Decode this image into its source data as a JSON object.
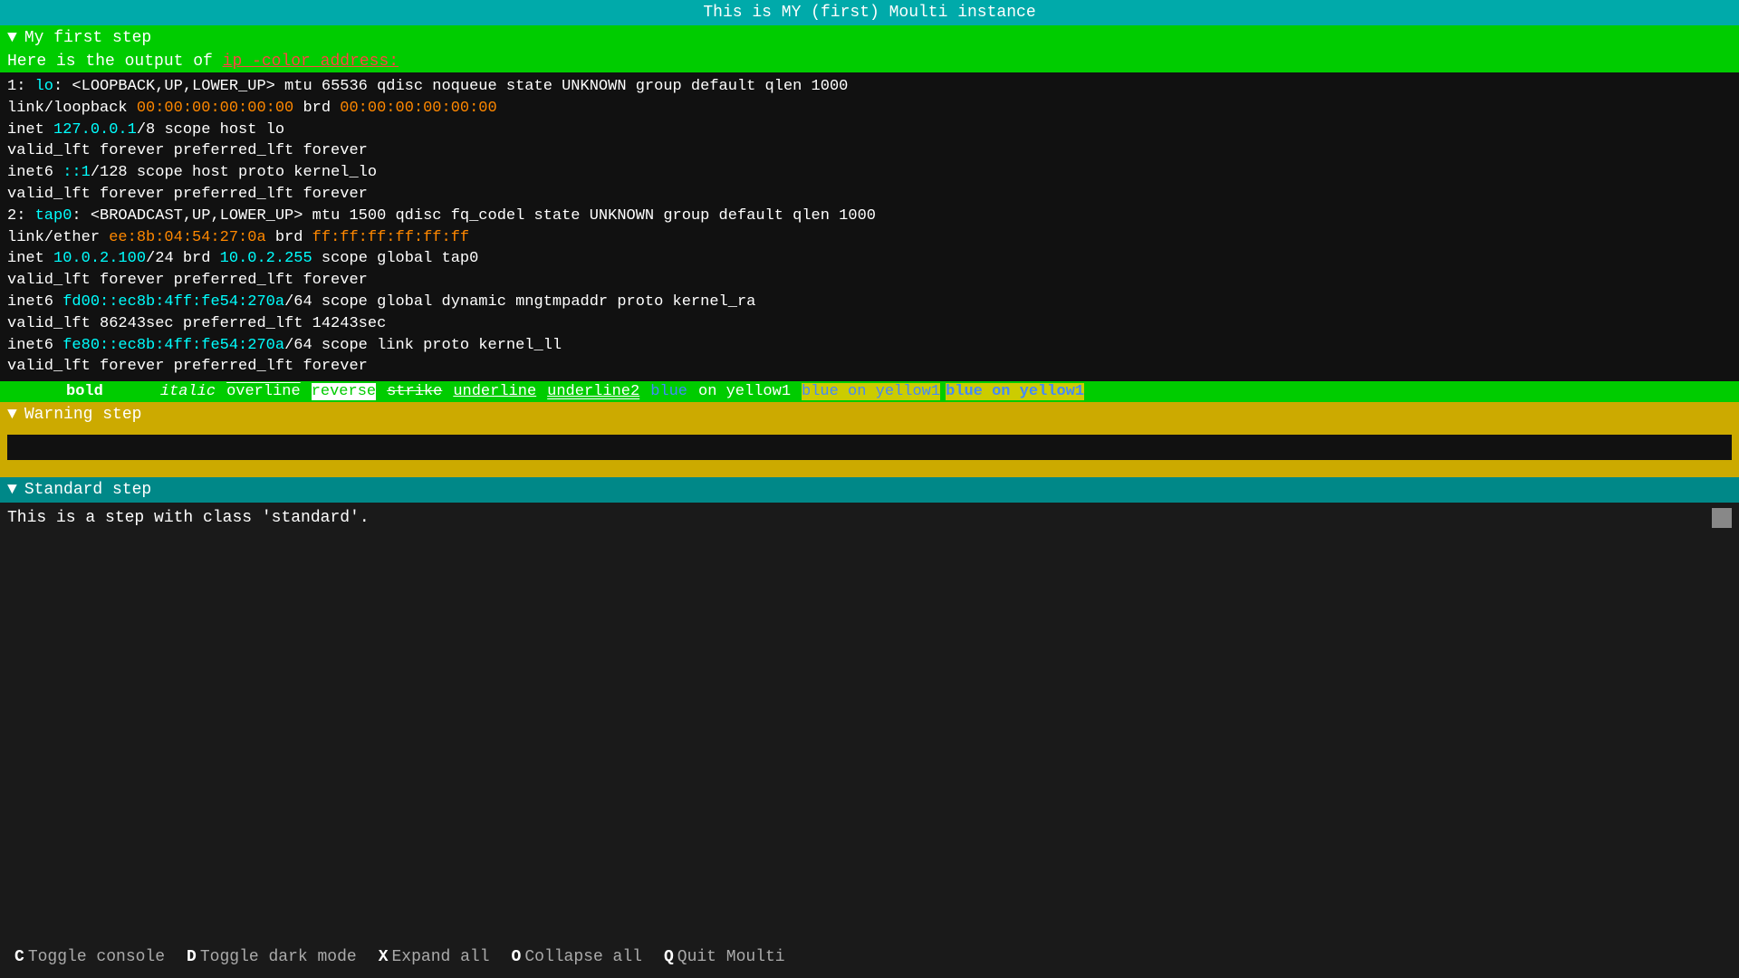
{
  "title": "This is MY (first) Moulti instance",
  "steps": [
    {
      "id": "step1",
      "class": "step-1",
      "arrow": "▼",
      "label": "My first step",
      "intro_text": "Here is the output of ",
      "intro_cmd": "ip -color address:",
      "terminal_lines": [
        {
          "parts": [
            {
              "text": "1: ",
              "color": "white"
            },
            {
              "text": "lo",
              "color": "cyan"
            },
            {
              "text": ": <LOOPBACK,UP,LOWER_UP> mtu 65536 qdisc noqueue state UNKNOWN group default qlen 1000",
              "color": "white"
            }
          ]
        },
        {
          "parts": [
            {
              "text": "    link/loopback ",
              "color": "white"
            },
            {
              "text": "00:00:00:00:00:00",
              "color": "orange"
            },
            {
              "text": " brd ",
              "color": "white"
            },
            {
              "text": "00:00:00:00:00:00",
              "color": "orange"
            }
          ]
        },
        {
          "parts": [
            {
              "text": "    inet ",
              "color": "white"
            },
            {
              "text": "127.0.0.1",
              "color": "cyan"
            },
            {
              "text": "/8 scope host lo",
              "color": "white"
            }
          ]
        },
        {
          "parts": [
            {
              "text": "       valid_lft forever preferred_lft forever",
              "color": "white"
            }
          ]
        },
        {
          "parts": [
            {
              "text": "    inet6 ",
              "color": "white"
            },
            {
              "text": "::1",
              "color": "cyan"
            },
            {
              "text": "/128 scope host proto kernel_lo",
              "color": "white"
            }
          ]
        },
        {
          "parts": [
            {
              "text": "       valid_lft forever preferred_lft forever",
              "color": "white"
            }
          ]
        },
        {
          "parts": [
            {
              "text": "2: ",
              "color": "white"
            },
            {
              "text": "tap0",
              "color": "cyan"
            },
            {
              "text": ": <BROADCAST,UP,LOWER_UP> mtu 1500 qdisc fq_codel state UNKNOWN group default qlen 1000",
              "color": "white"
            }
          ]
        },
        {
          "parts": [
            {
              "text": "    link/ether ",
              "color": "white"
            },
            {
              "text": "ee:8b:04:54:27:0a",
              "color": "orange"
            },
            {
              "text": " brd ",
              "color": "white"
            },
            {
              "text": "ff:ff:ff:ff:ff:ff",
              "color": "orange"
            }
          ]
        },
        {
          "parts": [
            {
              "text": "    inet ",
              "color": "white"
            },
            {
              "text": "10.0.2.100",
              "color": "cyan"
            },
            {
              "text": "/24 brd ",
              "color": "white"
            },
            {
              "text": "10.0.2.255",
              "color": "cyan"
            },
            {
              "text": " scope global tap0",
              "color": "white"
            }
          ]
        },
        {
          "parts": [
            {
              "text": "       valid_lft forever preferred_lft forever",
              "color": "white"
            }
          ]
        },
        {
          "parts": [
            {
              "text": "    inet6 ",
              "color": "white"
            },
            {
              "text": "fd00::ec8b:4ff:fe54:270a",
              "color": "cyan"
            },
            {
              "text": "/64 scope global dynamic mngtmpaddr proto kernel_ra",
              "color": "white"
            }
          ]
        },
        {
          "parts": [
            {
              "text": "       valid_lft 86243sec preferred_lft 14243sec",
              "color": "white"
            }
          ]
        },
        {
          "parts": [
            {
              "text": "    inet6 ",
              "color": "white"
            },
            {
              "text": "fe80::ec8b:4ff:fe54:270a",
              "color": "cyan"
            },
            {
              "text": "/64 scope link proto kernel_ll",
              "color": "white"
            }
          ]
        },
        {
          "parts": [
            {
              "text": "       valid_lft forever preferred_lft forever",
              "color": "white"
            }
          ]
        }
      ],
      "format_items": [
        {
          "text": "bold",
          "class": "fmt-bold"
        },
        {
          "text": "italic",
          "class": "fmt-italic"
        },
        {
          "text": "overline",
          "class": "fmt-overline"
        },
        {
          "text": "reverse",
          "class": "fmt-reverse"
        },
        {
          "text": "strike",
          "class": "fmt-strike"
        },
        {
          "text": "underline",
          "class": "fmt-underline"
        },
        {
          "text": "underline2",
          "class": "fmt-underline2"
        },
        {
          "text": "blue",
          "class": "fmt-blue"
        },
        {
          "text": "on yellow1",
          "class": ""
        },
        {
          "text": "blue on yellow1",
          "class": "fmt-blue-on-yellow"
        },
        {
          "text": "blue on yellow1",
          "class": "fmt-blue-on-yellow2"
        }
      ]
    },
    {
      "id": "step2",
      "class": "step-2",
      "arrow": "▼",
      "label": "Warning step"
    },
    {
      "id": "step3",
      "class": "step-3",
      "arrow": "▼",
      "label": "Standard step",
      "content": "This is a step with class 'standard'."
    }
  ],
  "toolbar": {
    "items": [
      {
        "key": "C",
        "label": "Toggle console"
      },
      {
        "key": "D",
        "label": "Toggle dark mode"
      },
      {
        "key": "X",
        "label": "Expand all"
      },
      {
        "key": "O",
        "label": "Collapse all"
      },
      {
        "key": "Q",
        "label": "Quit Moulti"
      }
    ]
  }
}
